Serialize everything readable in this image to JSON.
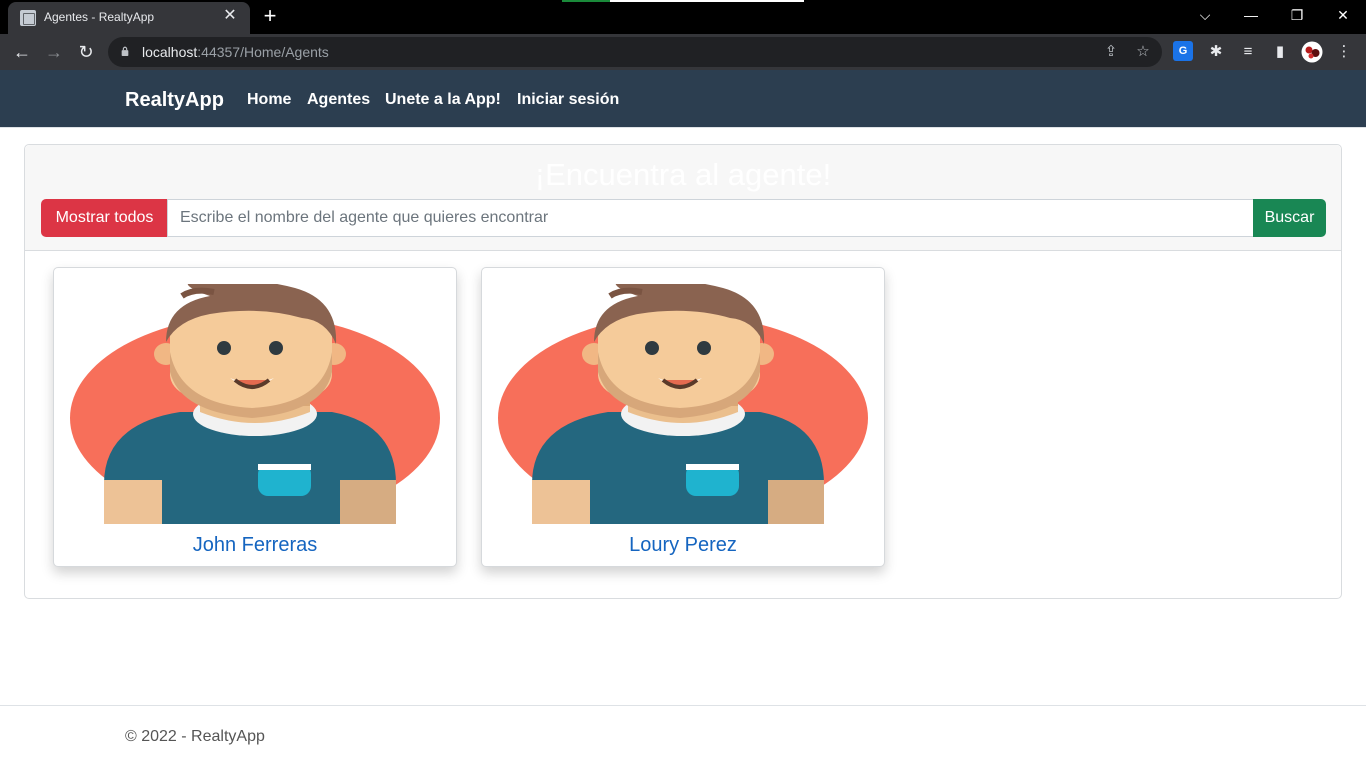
{
  "browser": {
    "tab_title": "Agentes - RealtyApp",
    "close_glyph": "✕",
    "newtab_glyph": "+",
    "url_host": "localhost",
    "url_rest": ":44357/Home/Agents",
    "window_controls": {
      "dropdown": "⌵",
      "minimize": "—",
      "restore": "❐",
      "close": "✕"
    },
    "nav_glyphs": {
      "back": "←",
      "forward": "→",
      "reload": "↻"
    },
    "omnibox_glyphs": {
      "share": "⇪",
      "bookmark": "☆"
    },
    "extension_glyphs": {
      "translate": "G",
      "extensions": "✱",
      "media": "≡",
      "sidepanel": "▮",
      "menu": "⋮"
    },
    "icons": [
      "lock-icon",
      "share-icon",
      "star-icon",
      "translate-icon",
      "extensions-icon",
      "media-icon",
      "side-panel-icon",
      "profile-avatar",
      "menu-icon"
    ]
  },
  "navbar": {
    "brand": "RealtyApp",
    "links": [
      "Home",
      "Agentes",
      "Unete a la App!",
      "Iniciar sesión"
    ]
  },
  "search": {
    "title": "¡Encuentra al agente!",
    "show_all_label": "Mostrar todos",
    "placeholder": "Escribe el nombre del agente que quieres encontrar",
    "value": "",
    "search_label": "Buscar"
  },
  "agents": [
    {
      "name": "John Ferreras",
      "avatar": "male-agent-avatar"
    },
    {
      "name": "Loury Perez",
      "avatar": "male-agent-avatar"
    }
  ],
  "footer": {
    "text": "© 2022 - RealtyApp"
  },
  "colors": {
    "navbar": "#2c3e50",
    "danger": "#dc3545",
    "success": "#198754",
    "agent_name": "#1565c0",
    "avatar_bg": "#f76f5a",
    "shirt": "#24677f",
    "pocket": "#1fb3cf",
    "skin": "#f4c896",
    "hair": "#8a6350"
  }
}
